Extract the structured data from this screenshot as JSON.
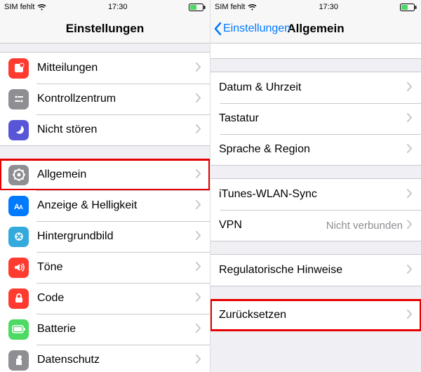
{
  "status": {
    "carrier": "SIM fehlt",
    "time": "17:30"
  },
  "left": {
    "title": "Einstellungen",
    "groups": [
      {
        "rows": [
          {
            "icon": "notifications",
            "bg": "bg-red",
            "label": "Mitteilungen"
          },
          {
            "icon": "control-center",
            "bg": "bg-gray",
            "label": "Kontrollzentrum"
          },
          {
            "icon": "dnd",
            "bg": "bg-purple",
            "label": "Nicht stören"
          }
        ]
      },
      {
        "rows": [
          {
            "icon": "general",
            "bg": "bg-gray",
            "label": "Allgemein",
            "highlight": true
          },
          {
            "icon": "display",
            "bg": "bg-blue",
            "label": "Anzeige & Helligkeit"
          },
          {
            "icon": "wallpaper",
            "bg": "bg-cyan",
            "label": "Hintergrundbild"
          },
          {
            "icon": "sounds",
            "bg": "bg-red",
            "label": "Töne"
          },
          {
            "icon": "passcode",
            "bg": "bg-red",
            "label": "Code"
          },
          {
            "icon": "battery",
            "bg": "bg-green",
            "label": "Batterie"
          },
          {
            "icon": "privacy",
            "bg": "bg-gray",
            "label": "Datenschutz"
          }
        ]
      }
    ]
  },
  "right": {
    "back": "Einstellungen",
    "title": "Allgemein",
    "groups": [
      {
        "rows": [
          {
            "label": ""
          }
        ],
        "blank": true
      },
      {
        "rows": [
          {
            "label": "Datum & Uhrzeit"
          },
          {
            "label": "Tastatur"
          },
          {
            "label": "Sprache & Region"
          }
        ]
      },
      {
        "rows": [
          {
            "label": "iTunes-WLAN-Sync"
          },
          {
            "label": "VPN",
            "detail": "Nicht verbunden"
          }
        ]
      },
      {
        "rows": [
          {
            "label": "Regulatorische Hinweise"
          }
        ]
      },
      {
        "rows": [
          {
            "label": "Zurücksetzen",
            "highlight": true
          }
        ]
      }
    ]
  }
}
